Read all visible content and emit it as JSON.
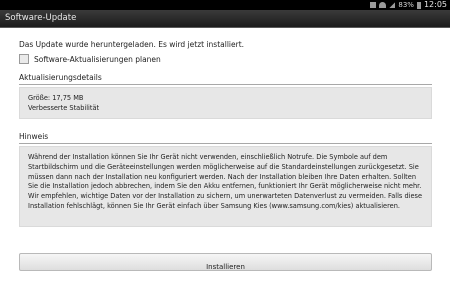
{
  "status_bar": {
    "battery": "83%",
    "time": "12:05"
  },
  "action_bar": {
    "title": "Software-Update"
  },
  "main": {
    "message": "Das Update wurde heruntergeladen. Es wird jetzt installiert.",
    "schedule_checkbox_label": "Software-Aktualisierungen planen",
    "details_title": "Aktualisierungsdetails",
    "details_size": "Größe: 17,75 MB",
    "details_change": "Verbesserte Stabilität",
    "notice_title": "Hinweis",
    "notice_text": "Während der Installation können Sie Ihr Gerät nicht verwenden, einschließlich Notrufe. Die Symbole auf dem Startbildschirm und die Geräteeinstellungen werden möglicherweise auf die Standardeinstellungen zurückgesetzt. Sie müssen dann nach der Installation neu konfiguriert werden. Nach der Installation bleiben Ihre Daten erhalten. Sollten Sie die Installation jedoch abbrechen, indem Sie den Akku entfernen, funktioniert Ihr Gerät möglicherweise nicht mehr. Wir empfehlen, wichtige Daten vor der Installation zu sichern, um unerwarteten Datenverlust zu vermeiden. Falls diese Installation fehlschlägt, können Sie Ihr Gerät einfach über Samsung Kies (www.samsung.com/kies) aktualisieren.",
    "install_button_label": "Installieren"
  }
}
